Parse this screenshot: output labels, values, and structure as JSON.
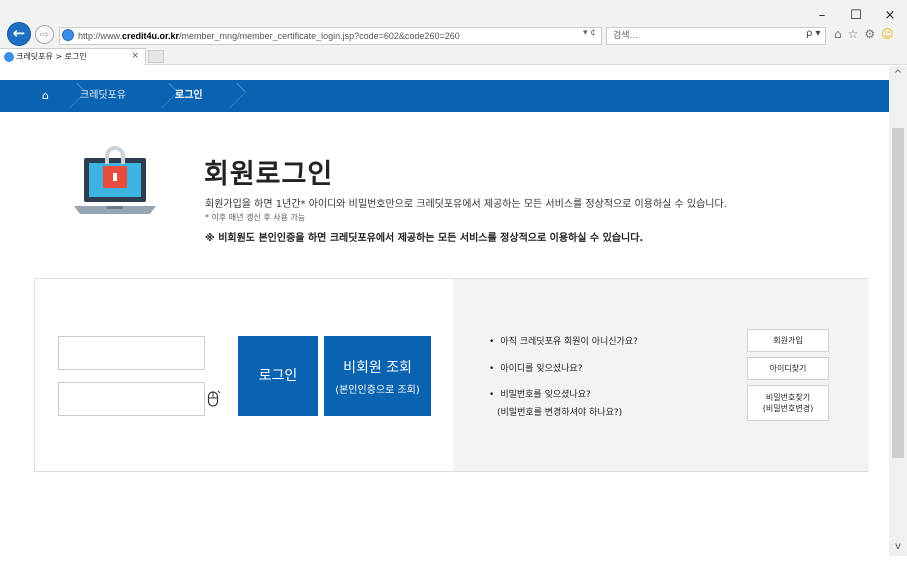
{
  "browser": {
    "address_prefix": "http://www.",
    "address_host": "credit4u.or.kr",
    "address_path": "/member_mng/member_certificate_login.jsp?code=602&code260=260",
    "address_tools": "▾ ¢",
    "search_placeholder": "검색...",
    "search_icon_glyph": "ρ ▾",
    "tab_title": "크레딧포유 > 로그인",
    "tab_close": "×",
    "win_minimize": "–",
    "win_maximize": "☐",
    "win_close": "×",
    "back_glyph": "←",
    "forward_glyph": "⇨",
    "home_glyph": "⌂",
    "favorites_glyph": "☆",
    "settings_glyph": "⚙",
    "smiley_glyph": "☺",
    "scroll_up_glyph": "^",
    "scroll_down_glyph": "v"
  },
  "nav": {
    "home_glyph": "⌂",
    "crumb1": "크레딧포유",
    "crumb2": "로그인"
  },
  "hero": {
    "title": "회원로그인",
    "desc1": "회원가입을 하면 1년간* 아이디와 비밀번호만으로 크레딧포유에서 제공하는 모든 서비스를 정상적으로 이용하실 수 있습니다.",
    "desc2": "* 이후 매년 갱신 후 사용 가능",
    "desc3": "※ 비회원도 본인인증을 하면 크레딧포유에서 제공하는 모든 서비스를 정상적으로 이용하실 수 있습니다."
  },
  "login": {
    "login_button": "로그인",
    "guest_button_line1": "비회원 조회",
    "guest_button_line2": "(본인인증으로 조회)"
  },
  "help": {
    "bullet": "•",
    "item1": "아직 크레딧포유 회원이 아니신가요?",
    "item2": "아이디를 잊으셨나요?",
    "item3": "비밀번호를 잊으셨나요?",
    "item3_sub": "(비밀번호를 변경하셔야 하나요?)",
    "signup_button": "회원가입",
    "find_id_button": "아이디찾기",
    "find_pw_line1": "비밀번호찾기",
    "find_pw_line2": "(비밀번호변경)"
  },
  "colors": {
    "brand_blue": "#0a63b0",
    "panel_gray": "#f3f3f3"
  }
}
